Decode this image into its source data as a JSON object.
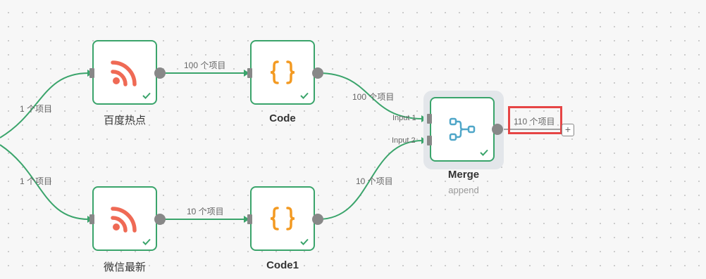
{
  "nodes": {
    "baidu": {
      "label": "百度热点",
      "icon": "rss-icon"
    },
    "code": {
      "label": "Code",
      "icon": "code-braces-icon"
    },
    "weixin": {
      "label": "微信最新",
      "icon": "rss-icon"
    },
    "code1": {
      "label": "Code1",
      "icon": "code-braces-icon"
    },
    "merge": {
      "label": "Merge",
      "sublabel": "append",
      "icon": "merge-icon",
      "input1": "Input 1",
      "input2": "Input 2"
    }
  },
  "edges": {
    "trigger_to_baidu": "1 个项目",
    "trigger_to_weixin": "1 个项目",
    "baidu_to_code": "100 个项目",
    "weixin_to_code1": "10 个项目",
    "code_to_merge": "100 个项目",
    "code1_to_merge": "10 个项目",
    "merge_output": "110 个项目"
  },
  "add_button": "+",
  "colors": {
    "edge": "#3aa46b",
    "node_border": "#3aa46b",
    "rss": "#ef6a55",
    "code": "#f39a22",
    "merge": "#4fa6c8",
    "highlight": "#e64545"
  }
}
